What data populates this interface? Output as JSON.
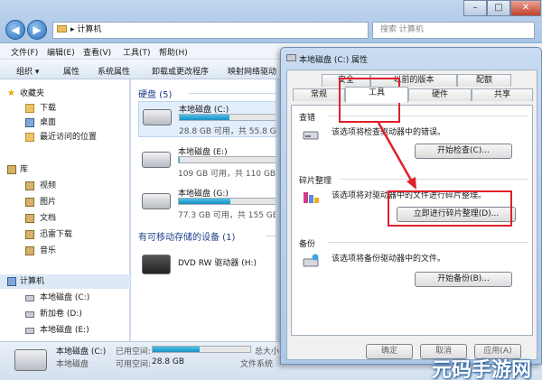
{
  "explorer": {
    "address": "计算机",
    "search_placeholder": "搜索 计算机",
    "menu": [
      "文件(F)",
      "编辑(E)",
      "查看(V)",
      "工具(T)",
      "帮助(H)"
    ],
    "toolbar": [
      "组织 ▾",
      "属性",
      "系统属性",
      "卸载或更改程序",
      "映射网络驱动"
    ],
    "nav": {
      "favorites": "收藏夹",
      "fav_items": [
        "下载",
        "桌面",
        "最近访问的位置"
      ],
      "libraries": "库",
      "lib_items": [
        "视频",
        "图片",
        "文档",
        "迅雷下载",
        "音乐"
      ],
      "computer": "计算机",
      "drives": [
        "本地磁盘 (C:)",
        "新加卷 (D:)",
        "本地磁盘 (E:)"
      ]
    },
    "groups": {
      "hdd": "硬盘 (5)",
      "removable": "有可移动存储的设备 (1)"
    },
    "drives": [
      {
        "name": "本地磁盘 (C:)",
        "size": "28.8 GB 可用，共 55.8 GB",
        "used": 0.48
      },
      {
        "name": "本地磁盘 (E:)",
        "size": "109 GB 可用，共 110 GB",
        "used": 0.01
      },
      {
        "name": "本地磁盘 (G:)",
        "size": "77.3 GB 可用，共 155 GB",
        "used": 0.5
      }
    ],
    "dvd": "DVD RW 驱动器 (H:)",
    "details": {
      "name": "本地磁盘 (C:)",
      "type": "本地磁盘",
      "used_label": "已用空间:",
      "free_label": "可用空间:",
      "free_value": "28.8 GB",
      "total_label": "总大小",
      "fs_label": "文件系统",
      "used": 0.48
    }
  },
  "dialog": {
    "title": "本地磁盘 (C:) 属性",
    "tabs_row1": [
      "安全",
      "以前的版本",
      "配额"
    ],
    "tabs_row2": [
      "常规",
      "工具",
      "硬件",
      "共享"
    ],
    "sections": {
      "check": {
        "label": "查错",
        "text": "该选项将检查驱动器中的错误。",
        "button": "开始检查(C)..."
      },
      "defrag": {
        "label": "碎片整理",
        "text": "该选项将对驱动器中的文件进行碎片整理。",
        "button": "立即进行碎片整理(D)..."
      },
      "backup": {
        "label": "备份",
        "text": "该选项将备份驱动器中的文件。",
        "button": "开始备份(B)..."
      }
    },
    "buttons": {
      "ok": "确定",
      "cancel": "取消",
      "apply": "应用(A)"
    },
    "colors": {
      "highlight": "#e0202a"
    }
  },
  "watermark": "元码手游网"
}
